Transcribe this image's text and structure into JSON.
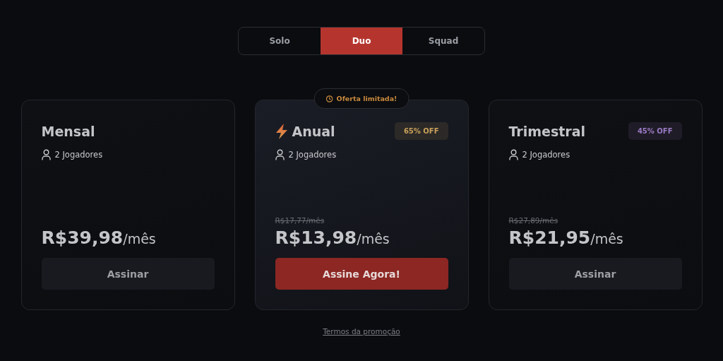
{
  "tabs": [
    {
      "label": "Solo",
      "selected": false
    },
    {
      "label": "Duo",
      "selected": true
    },
    {
      "label": "Squad",
      "selected": false
    }
  ],
  "plans": [
    {
      "title": "Mensal",
      "featured": false,
      "players": "2 Jogadores",
      "price": "R$39,98",
      "period": "/mês",
      "button": {
        "label": "Assinar",
        "primary": false
      }
    },
    {
      "title": "Anual",
      "featured": true,
      "ribbon": "Oferta limitada!",
      "discount": {
        "text": "65% OFF",
        "color": "#c9a15a"
      },
      "players": "2 Jogadores",
      "old_price": "R$17,77/mês",
      "price": "R$13,98",
      "period": "/mês",
      "button": {
        "label": "Assine Agora!",
        "primary": true
      }
    },
    {
      "title": "Trimestral",
      "featured": false,
      "discount": {
        "text": "45% OFF",
        "color": "#9b7bc4"
      },
      "players": "2 Jogadores",
      "old_price": "R$27,89/mês",
      "price": "R$21,95",
      "period": "/mês",
      "button": {
        "label": "Assinar",
        "primary": false
      }
    }
  ],
  "footer_link": "Termos da promoção"
}
